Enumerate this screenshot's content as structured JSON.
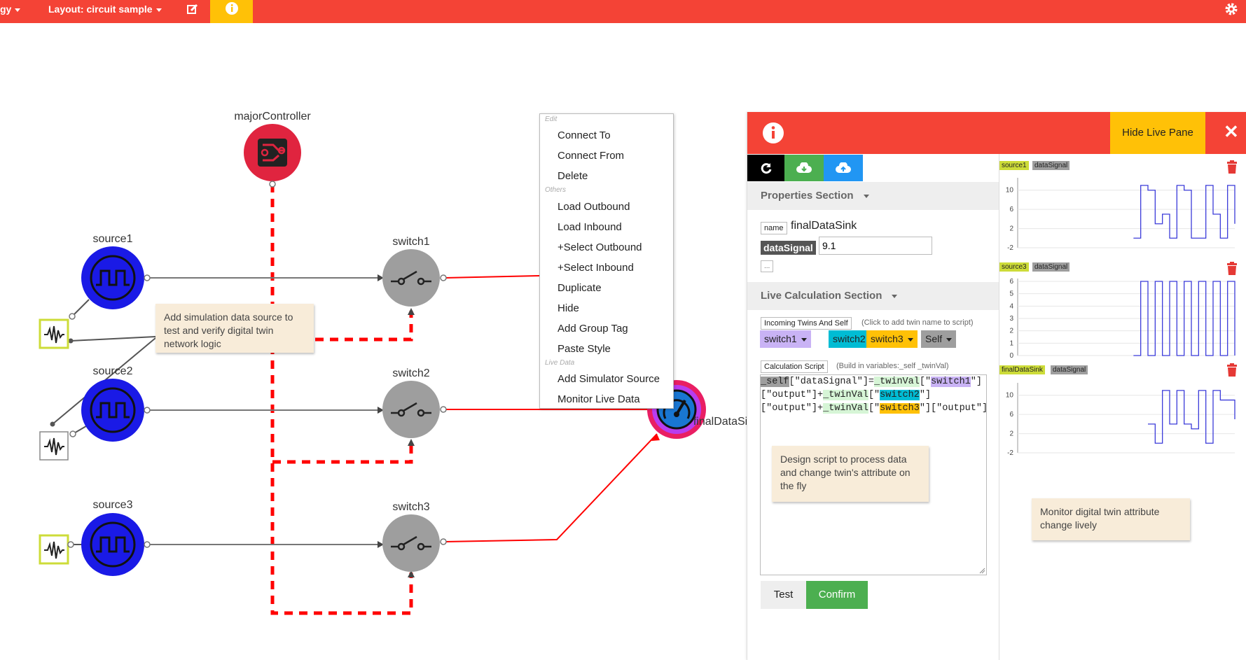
{
  "topbar": {
    "menu_fragment": "gy",
    "layout_label": "Layout: circuit sample"
  },
  "nodes": {
    "majorController": "majorController",
    "source1": "source1",
    "source2": "source2",
    "source3": "source3",
    "switch1": "switch1",
    "switch2": "switch2",
    "switch3": "switch3",
    "finalDataSink": "finalDataSink"
  },
  "tips": {
    "simulation": "Add simulation data source to test and verify digital twin network logic",
    "script": "Design script to process data and change twin's attribute on the fly",
    "monitor": "Monitor digital twin attribute change lively"
  },
  "context_menu": {
    "edit_section": "Edit",
    "others_section": "Others",
    "live_section": "Live Data",
    "connect_to": "Connect To",
    "connect_from": "Connect From",
    "delete": "Delete",
    "load_outbound": "Load Outbound",
    "load_inbound": "Load Inbound",
    "select_outbound": "+Select Outbound",
    "select_inbound": "+Select Inbound",
    "duplicate": "Duplicate",
    "hide": "Hide",
    "add_group_tag": "Add Group Tag",
    "paste_style": "Paste Style",
    "add_simulator_source": "Add Simulator Source",
    "monitor_live_data": "Monitor Live Data"
  },
  "live_pane": {
    "hide_label": "Hide Live Pane",
    "close_glyph": "✕",
    "properties_section": "Properties Section",
    "name_key": "name",
    "name_value": "finalDataSink",
    "attr_key": "dataSignal",
    "attr_value": "9.1",
    "more_button": "...",
    "live_calc_section": "Live Calculation Section",
    "incoming_label": "Incoming Twins And Self",
    "incoming_hint": "(Click to add twin name to script)",
    "twin_chips": [
      "switch1",
      "switch2",
      "switch3",
      "Self"
    ],
    "calc_label": "Calculation Script",
    "calc_hint": "(Build in variables:_self _twinVal)",
    "script_line1": [
      "_self",
      "[\"dataSignal\"]=",
      "_twinVal",
      "[\"",
      "switch1",
      "\"]"
    ],
    "script_line2": [
      "[\"output\"]+",
      "_twinVal",
      "[\"",
      "switch2",
      "\"]"
    ],
    "script_line3": [
      "[\"output\"]+",
      "_twinVal",
      "[\"",
      "switch3",
      "\"][\"output\"]"
    ],
    "test_button": "Test",
    "confirm_button": "Confirm"
  },
  "colors": {
    "topbar": "#f44336",
    "accent_yellow": "#ffc107",
    "source_blue": "#1a1ae6",
    "switch_gray": "#9e9e9e",
    "link_red": "#f00",
    "confirm_green": "#4caf50",
    "chip_purple": "#c9b3f5",
    "chip_cyan": "#00bcd4",
    "chip_gold": "#ffc107",
    "chip_gray": "#9e9e9e",
    "chart_line": "#3b3bd9"
  },
  "icons": [
    "gear-icon",
    "edit-icon",
    "info-icon",
    "refresh-icon",
    "cloud-download-icon",
    "cloud-upload-icon",
    "trash-icon",
    "square-wave-icon",
    "switch-icon",
    "gauge-icon",
    "circuit-icon",
    "waveform-icon"
  ],
  "chart_data": [
    {
      "type": "line",
      "step": true,
      "twin": "source1",
      "attribute": "dataSignal",
      "yticks": [
        10,
        6,
        2,
        -2
      ],
      "ylim": [
        -2,
        12
      ],
      "x": [
        0,
        1,
        2,
        3,
        4,
        5,
        6,
        7,
        8,
        9,
        10,
        11,
        12,
        13,
        14,
        15,
        16,
        17,
        18,
        19,
        20,
        21,
        22,
        23,
        24,
        25,
        26,
        27,
        28,
        29,
        30
      ],
      "values": [
        null,
        null,
        null,
        null,
        null,
        null,
        null,
        null,
        null,
        null,
        null,
        null,
        null,
        null,
        null,
        null,
        0,
        11,
        10,
        3,
        5,
        0,
        11,
        10,
        0,
        0,
        11,
        5,
        0,
        11,
        3
      ]
    },
    {
      "type": "line",
      "step": true,
      "twin": "source3",
      "attribute": "dataSignal",
      "yticks": [
        6,
        5,
        4,
        3,
        2,
        1,
        0
      ],
      "ylim": [
        0,
        6
      ],
      "x": [
        0,
        1,
        2,
        3,
        4,
        5,
        6,
        7,
        8,
        9,
        10,
        11,
        12,
        13,
        14,
        15,
        16,
        17,
        18,
        19,
        20,
        21,
        22,
        23,
        24,
        25,
        26,
        27,
        28,
        29,
        30
      ],
      "values": [
        null,
        null,
        null,
        null,
        null,
        null,
        null,
        null,
        null,
        null,
        null,
        null,
        null,
        null,
        null,
        null,
        0,
        6,
        0,
        6,
        0,
        6,
        0,
        6,
        0,
        6,
        0,
        6,
        0,
        6,
        0
      ]
    },
    {
      "type": "line",
      "step": true,
      "twin": "finalDataSink",
      "attribute": "dataSignal",
      "yticks": [
        10,
        6,
        2,
        -2
      ],
      "ylim": [
        -2,
        12
      ],
      "x": [
        0,
        1,
        2,
        3,
        4,
        5,
        6,
        7,
        8,
        9,
        10,
        11,
        12,
        13,
        14,
        15,
        16,
        17,
        18,
        19,
        20,
        21,
        22,
        23,
        24,
        25,
        26,
        27,
        28,
        29,
        30
      ],
      "values": [
        null,
        null,
        null,
        null,
        null,
        null,
        null,
        null,
        null,
        null,
        null,
        null,
        null,
        null,
        null,
        null,
        null,
        null,
        4,
        0,
        11,
        4,
        11,
        4,
        3,
        11,
        0,
        11,
        9,
        9,
        5
      ]
    }
  ]
}
